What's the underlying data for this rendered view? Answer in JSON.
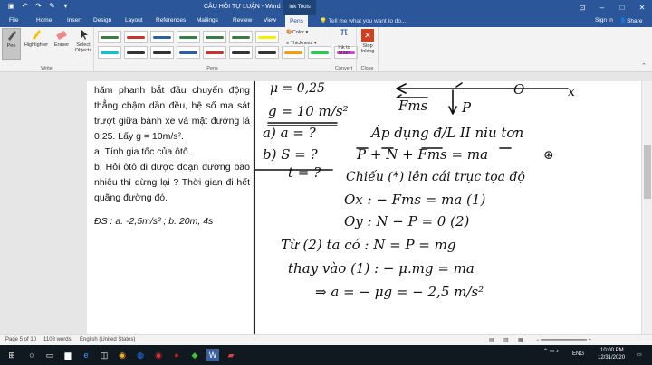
{
  "window": {
    "title": "CÂU HỎI TỰ LUẬN - Word",
    "context_tab": "Ink Tools"
  },
  "tabs": [
    {
      "label": "File"
    },
    {
      "label": "Home"
    },
    {
      "label": "Insert"
    },
    {
      "label": "Design"
    },
    {
      "label": "Layout"
    },
    {
      "label": "References"
    },
    {
      "label": "Mailings"
    },
    {
      "label": "Review"
    },
    {
      "label": "View"
    },
    {
      "label": "Pens"
    }
  ],
  "tell_me": "Tell me what you want to do...",
  "sign_in": "Sign in",
  "share": "Share",
  "ribbon": {
    "write": {
      "pen": "Pen",
      "highlighter": "Highlighter",
      "eraser": "Eraser",
      "select": "Select Objects",
      "group": "Write"
    },
    "pens_group": "Pens",
    "color": "Color",
    "thickness": "Thickness",
    "ink_to_math": "Ink to Math",
    "convert_group": "Convert",
    "stop_inking": "Stop Inking",
    "close_group": "Close",
    "pen_colors": [
      "#3a7d44",
      "#c8342e",
      "#2d5fa8",
      "#3a7d44",
      "#3a7d44",
      "#3a7d44",
      "#f2f200",
      "#00c8d8",
      "#333333",
      "#333333",
      "#2d5fa8",
      "#c8342e",
      "#333333",
      "#333333",
      "#f6a000",
      "#20d04a",
      "#e040e0"
    ]
  },
  "document": {
    "lines": [
      "hãm phanh bắt đầu chuyển động thẳng chậm dần đều, hệ số ma sát trượt giữa bánh xe và mặt đường là 0,25. Lấy g = 10m/s².",
      "a. Tính gia tốc của ôtô.",
      "b. Hỏi ôtô đi được đoạn đường bao nhiêu thì dừng lại ? Thời gian đi hết quãng đường đó."
    ],
    "answer": "ĐS : a. -2,5m/s² ; b. 20m, 4s"
  },
  "ink": {
    "mu": "μ = 0,25",
    "g": "g = 10 m/s²",
    "a_q": "a) a = ?",
    "b_q": "b) S = ?",
    "t_q": "t = ?",
    "fms_label": "Fms",
    "p_label": "P",
    "o_label": "O",
    "x_label": "x",
    "apply": "Áp dụng đ/L II niu tơn",
    "vec_eq": "P + N + Fms = ma",
    "project": "Chiếu (*) lên cái trục tọa độ",
    "ox_eq": "Ox : − Fms = ma (1)",
    "oy_eq": "Oy : N − P = 0 (2)",
    "from2": "Từ (2) ta có : N = P = mg",
    "sub1": "thay vào (1) : − μ.mg = ma",
    "result": "⇒ a = − μg = − 2,5 m/s²"
  },
  "status": {
    "page": "Page 5 of 10",
    "words": "1108 words",
    "language": "English (United States)"
  },
  "clock": {
    "time": "10:00 PM",
    "date": "12/31/2020",
    "lang": "ENG"
  }
}
